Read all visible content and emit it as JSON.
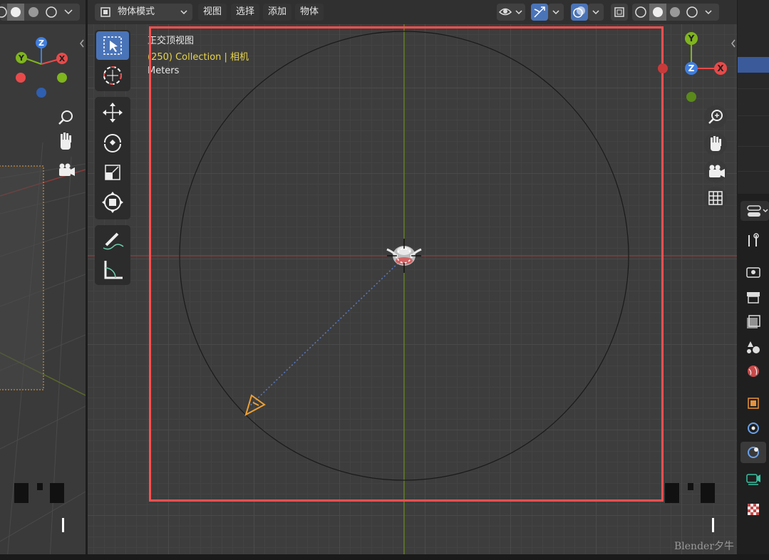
{
  "header": {
    "mode_selector": "物体模式",
    "menus": [
      "视图",
      "选择",
      "添加",
      "物体"
    ]
  },
  "overlay_info": {
    "view_name": "正交顶视图",
    "collection_line": "(250) Collection | 相机",
    "units": "Meters"
  },
  "gizmo": {
    "main": {
      "axis_z": "Z",
      "axis_y": "Y",
      "axis_x": "X"
    },
    "left": {
      "axis_z": "Z",
      "axis_y": "Y",
      "axis_x": "X"
    }
  },
  "watermark": "Blender夕牛",
  "colors": {
    "selection_frame": "#ff4f4f",
    "axis_x": "#e84a4a",
    "axis_y": "#7fb51d",
    "axis_z": "#3f7fe0",
    "active_tool": "#4a74b8",
    "camera": "#f0a030"
  },
  "icons": {
    "tools": [
      "select-box-icon",
      "cursor-icon",
      "move-icon",
      "rotate-icon",
      "scale-icon",
      "transform-icon",
      "annotate-icon",
      "measure-icon"
    ],
    "navigation": [
      "zoom-icon",
      "hand-pan-icon",
      "camera-view-icon",
      "grid-icon"
    ],
    "properties_tabs": [
      "tool-icon",
      "render-icon",
      "output-icon",
      "view-layer-icon",
      "scene-icon",
      "world-icon",
      "object-icon",
      "modifier-icon",
      "physics-icon",
      "constraint-icon",
      "data-icon",
      "texture-icon"
    ]
  }
}
